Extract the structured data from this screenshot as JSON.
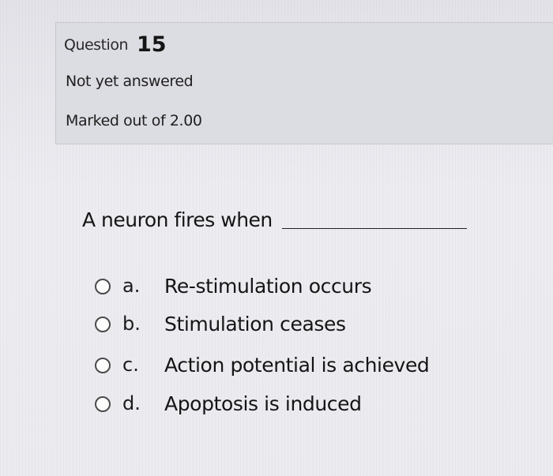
{
  "question_info": {
    "label": "Question",
    "number": "15",
    "state": "Not yet answered",
    "grade": "Marked out of 2.00"
  },
  "question": {
    "text": "A neuron fires when"
  },
  "options": [
    {
      "letter": "a.",
      "text": "Re-stimulation occurs"
    },
    {
      "letter": "b.",
      "text": "Stimulation ceases"
    },
    {
      "letter": "c.",
      "text": "Action potential is achieved"
    },
    {
      "letter": "d.",
      "text": "Apoptosis is induced"
    }
  ]
}
